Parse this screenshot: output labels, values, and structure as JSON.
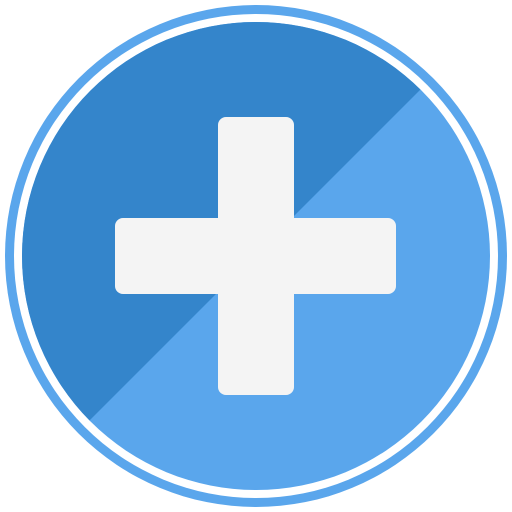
{
  "icon": {
    "name": "plus-icon",
    "colors": {
      "background": "#ffffff",
      "outer_ring": "#5aa6ec",
      "inner_gap": "#ffffff",
      "circle_dark": "#3485cb",
      "circle_light": "#5aa6ec",
      "plus": "#f4f4f4"
    }
  }
}
